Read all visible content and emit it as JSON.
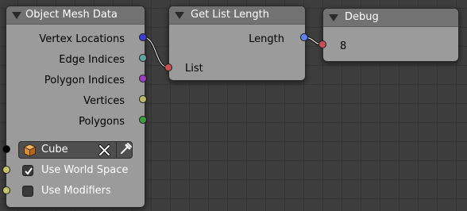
{
  "nodes": {
    "object_mesh_data": {
      "title": "Object Mesh Data",
      "outputs": [
        "Vertex Locations",
        "Edge Indices",
        "Polygon Indices",
        "Vertices",
        "Polygons"
      ],
      "object_field": {
        "value": "Cube"
      },
      "use_world_space": {
        "label": "Use World Space",
        "checked": true
      },
      "use_modifiers": {
        "label": "Use Modifiers",
        "checked": false
      }
    },
    "get_list_length": {
      "title": "Get List Length",
      "output_label": "Length",
      "input_label": "List"
    },
    "debug": {
      "title": "Debug",
      "value": "8"
    }
  },
  "socket_colors": {
    "vector_list": "#3d3dd6",
    "edge_indices": "#5fa6a0",
    "polygon_indices": "#9a3fbd",
    "generic_list": "#b9b96a",
    "polygon_list": "#3d9a3d",
    "object": "#000000",
    "boolean": "#c4c46a",
    "integer": "#5f7ff5",
    "generic": "#c85050"
  }
}
